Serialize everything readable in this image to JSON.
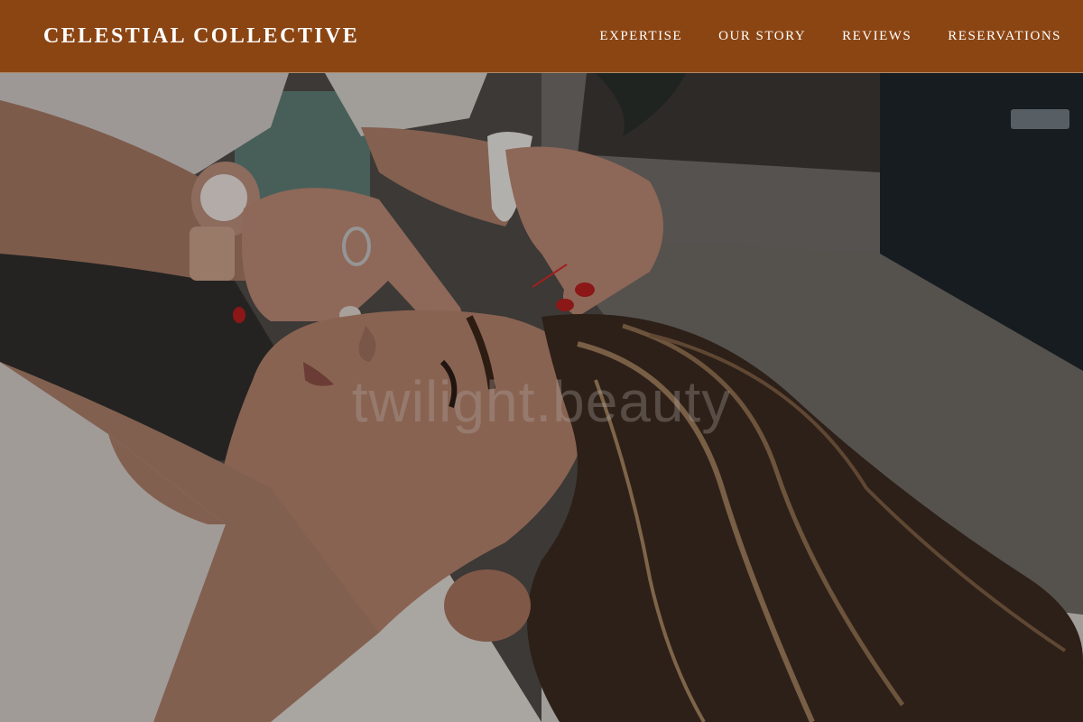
{
  "header": {
    "brand": "CELESTIAL COLLECTIVE",
    "background_color": "#8b4513",
    "nav_items": [
      {
        "label": "EXPERTISE"
      },
      {
        "label": "OUR STORY"
      },
      {
        "label": "REVIEWS"
      },
      {
        "label": "RESERVATIONS"
      }
    ]
  },
  "hero": {
    "image_description_icon": "facial-acupuncture-photo",
    "watermark": "twilight.beauty"
  }
}
